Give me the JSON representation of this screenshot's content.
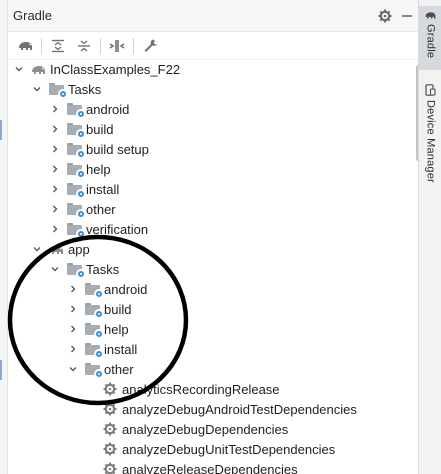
{
  "header": {
    "title": "Gradle"
  },
  "titlebar_icons": [
    "gear-icon",
    "minimize-icon"
  ],
  "toolbar": {
    "tools": [
      "gradle-elephant-icon",
      "expand-all-icon",
      "collapse-all-icon",
      "toggle-offline-icon",
      "build-settings-icon"
    ]
  },
  "tree": [
    {
      "label": "InClassExamples_F22",
      "indent": 0,
      "chevron": "down",
      "icon": "elephant"
    },
    {
      "label": "Tasks",
      "indent": 1,
      "chevron": "down",
      "icon": "folder"
    },
    {
      "label": "android",
      "indent": 2,
      "chevron": "right",
      "icon": "folder"
    },
    {
      "label": "build",
      "indent": 2,
      "chevron": "right",
      "icon": "folder"
    },
    {
      "label": "build setup",
      "indent": 2,
      "chevron": "right",
      "icon": "folder"
    },
    {
      "label": "help",
      "indent": 2,
      "chevron": "right",
      "icon": "folder"
    },
    {
      "label": "install",
      "indent": 2,
      "chevron": "right",
      "icon": "folder"
    },
    {
      "label": "other",
      "indent": 2,
      "chevron": "right",
      "icon": "folder"
    },
    {
      "label": "verification",
      "indent": 2,
      "chevron": "right",
      "icon": "folder"
    },
    {
      "label": "app",
      "indent": 1,
      "chevron": "down",
      "icon": "elephant"
    },
    {
      "label": "Tasks",
      "indent": 2,
      "chevron": "down",
      "icon": "folder"
    },
    {
      "label": "android",
      "indent": 3,
      "chevron": "right",
      "icon": "folder"
    },
    {
      "label": "build",
      "indent": 3,
      "chevron": "right",
      "icon": "folder"
    },
    {
      "label": "help",
      "indent": 3,
      "chevron": "right",
      "icon": "folder"
    },
    {
      "label": "install",
      "indent": 3,
      "chevron": "right",
      "icon": "folder"
    },
    {
      "label": "other",
      "indent": 3,
      "chevron": "down",
      "icon": "folder"
    },
    {
      "label": "analyticsRecordingRelease",
      "indent": 4,
      "chevron": "none",
      "icon": "gear"
    },
    {
      "label": "analyzeDebugAndroidTestDependencies",
      "indent": 4,
      "chevron": "none",
      "icon": "gear"
    },
    {
      "label": "analyzeDebugDependencies",
      "indent": 4,
      "chevron": "none",
      "icon": "gear"
    },
    {
      "label": "analyzeDebugUnitTestDependencies",
      "indent": 4,
      "chevron": "none",
      "icon": "gear"
    },
    {
      "label": "analyzeReleaseDependencies",
      "indent": 4,
      "chevron": "none",
      "icon": "gear"
    }
  ],
  "side_tabs": [
    {
      "label": "Gradle",
      "icon": "gradle-elephant-icon",
      "active": true
    },
    {
      "label": "Device Manager",
      "icon": "device-manager-icon",
      "active": false
    }
  ],
  "colors": {
    "accent_gear": "#3d8fd6",
    "folder": "#a8adb3",
    "annotation": "#000000"
  }
}
